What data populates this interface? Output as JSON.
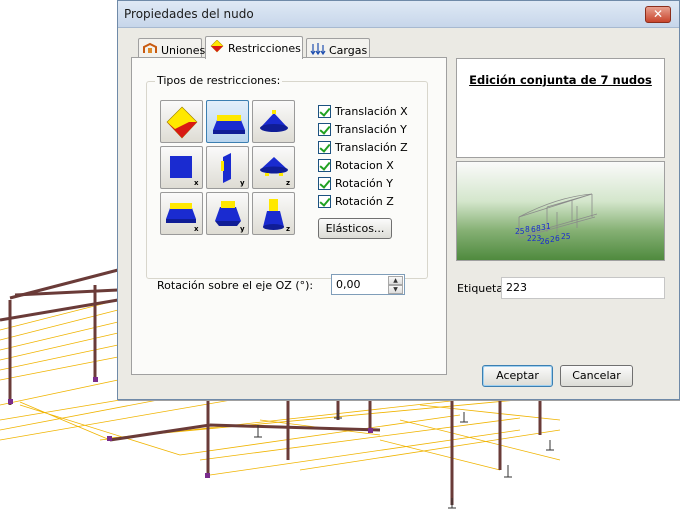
{
  "dialog": {
    "title": "Propiedades del nudo",
    "close_glyph": "✕"
  },
  "tabs": [
    {
      "label": "Uniones",
      "icon": "joints-icon"
    },
    {
      "label": "Restricciones",
      "icon": "restrictions-icon"
    },
    {
      "label": "Cargas",
      "icon": "loads-icon"
    }
  ],
  "restrictions": {
    "group_title": "Tipos de restricciones:",
    "buttons": [
      {
        "icon": "fixed-support-icon"
      },
      {
        "icon": "pinned-support-icon"
      },
      {
        "icon": "roller-support-icon"
      },
      {
        "icon": "x-restraint-icon",
        "axis": "x"
      },
      {
        "icon": "y-restraint-icon",
        "axis": "y"
      },
      {
        "icon": "z-restraint-icon",
        "axis": "z"
      },
      {
        "icon": "x-rotation-restraint-icon",
        "axis": "x"
      },
      {
        "icon": "y-rotation-restraint-icon",
        "axis": "y"
      },
      {
        "icon": "z-rotation-restraint-icon",
        "axis": "z"
      }
    ],
    "checks": [
      {
        "label": "Translación X",
        "checked": true
      },
      {
        "label": "Translación Y",
        "checked": true
      },
      {
        "label": "Translación Z",
        "checked": true
      },
      {
        "label": "Rotacion X",
        "checked": true
      },
      {
        "label": "Rotación Y",
        "checked": true
      },
      {
        "label": "Rotación Z",
        "checked": true
      }
    ],
    "elastic_label": "Elásticos...",
    "rotation_label": "Rotación sobre el eje OZ (°):",
    "rotation_value": "0,00"
  },
  "info": {
    "title": "Edición conjunta de 7 nudos",
    "node_labels": [
      "25",
      "8",
      "6",
      "8",
      "3",
      "1",
      "223",
      "26",
      "2",
      "6",
      "25"
    ]
  },
  "etiqueta": {
    "label": "Etiqueta:",
    "value": "223"
  },
  "buttons": {
    "accept": "Aceptar",
    "cancel": "Cancelar"
  },
  "colors": {
    "restraint_blue": "#1a2bd0",
    "restraint_yellow": "#ffe800",
    "restraint_red": "#d81a14",
    "cad_yellow": "#f0b400",
    "cad_frame": "#6a3b38",
    "preview_green": "#4f8a3e",
    "accent_blue": "#3c7fb1"
  }
}
